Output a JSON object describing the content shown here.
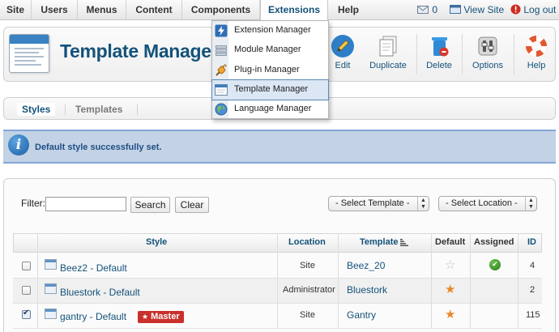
{
  "menubar": {
    "items": [
      {
        "label": "Site"
      },
      {
        "label": "Users"
      },
      {
        "label": "Menus"
      },
      {
        "label": "Content"
      },
      {
        "label": "Components"
      },
      {
        "label": "Extensions"
      },
      {
        "label": "Help"
      }
    ],
    "messages_count": "0",
    "view_site": "View Site",
    "logout": "Log out"
  },
  "extensions_menu": {
    "items": [
      {
        "label": "Extension Manager",
        "icon": "lightning-icon"
      },
      {
        "label": "Module Manager",
        "icon": "module-icon"
      },
      {
        "label": "Plug-in Manager",
        "icon": "plug-icon"
      },
      {
        "label": "Template Manager",
        "icon": "template-icon",
        "highlighted": true
      },
      {
        "label": "Language Manager",
        "icon": "globe-icon"
      }
    ]
  },
  "toolbar": {
    "title": "Template Manager",
    "edit": "Edit",
    "duplicate": "Duplicate",
    "delete": "Delete",
    "options": "Options",
    "help": "Help"
  },
  "tabs": {
    "styles": "Styles",
    "templates": "Templates"
  },
  "message": {
    "text": "Default style successfully set."
  },
  "filter": {
    "label": "Filter:",
    "value": "",
    "search": "Search",
    "clear": "Clear",
    "select_template": "- Select Template -",
    "select_location": "- Select Location -"
  },
  "table": {
    "headers": {
      "style": "Style",
      "location": "Location",
      "template": "Template",
      "default": "Default",
      "assigned": "Assigned",
      "id": "ID"
    },
    "rows": [
      {
        "style": "Beez2 - Default",
        "location": "Site",
        "template": "Beez_20",
        "is_default": false,
        "assigned": true,
        "id": "4",
        "checked": false
      },
      {
        "style": "Bluestork - Default",
        "location": "Administrator",
        "template": "Bluestork",
        "is_default": true,
        "assigned": false,
        "id": "2",
        "checked": false
      },
      {
        "style": "gantry - Default",
        "location": "Site",
        "template": "Gantry",
        "is_default": true,
        "assigned": false,
        "id": "115",
        "checked": true,
        "badge": "Master"
      }
    ]
  },
  "colors": {
    "link": "#14527a",
    "message_bg": "#c3d2e5",
    "star_on": "#e8892b",
    "master_badge": "#c9302c"
  }
}
